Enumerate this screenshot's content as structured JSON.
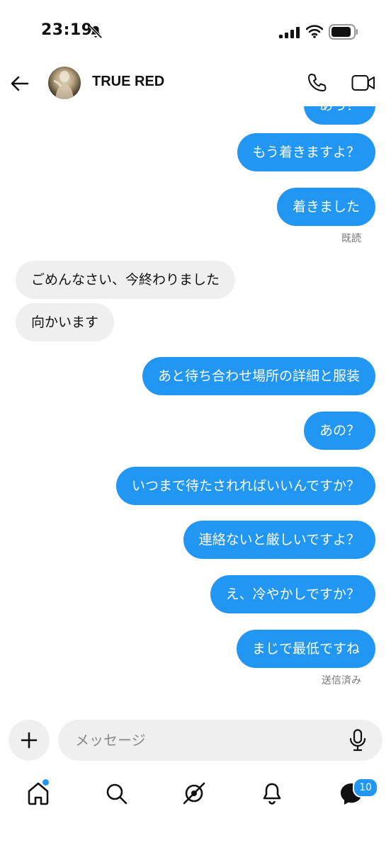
{
  "status_bar": {
    "time": "23:19"
  },
  "header": {
    "title": "TRUE RED"
  },
  "messages": [
    {
      "side": "out",
      "text": "あっ？"
    },
    {
      "side": "out",
      "text": "もう着きますよ？"
    },
    {
      "side": "out",
      "text": "着きました"
    },
    {
      "side": "in",
      "text": "ごめんなさい、今終わりました"
    },
    {
      "side": "in",
      "text": "向かいます"
    },
    {
      "side": "out",
      "text": "あと待ち合わせ場所の詳細と服装"
    },
    {
      "side": "out",
      "text": "あの？"
    },
    {
      "side": "out",
      "text": "いつまで待たされればいいんですか？"
    },
    {
      "side": "out",
      "text": "連絡ないと厳しいですよ？"
    },
    {
      "side": "out",
      "text": "え、冷やかしですか？"
    },
    {
      "side": "out",
      "text": "まじで最低ですね"
    }
  ],
  "receipts": {
    "read": "既読",
    "sent": "送信済み"
  },
  "composer": {
    "placeholder": "メッセージ"
  },
  "tab_bar": {
    "messages_badge": "10"
  },
  "colors": {
    "accent": "#2196f3",
    "incoming_bubble": "#efefef"
  }
}
